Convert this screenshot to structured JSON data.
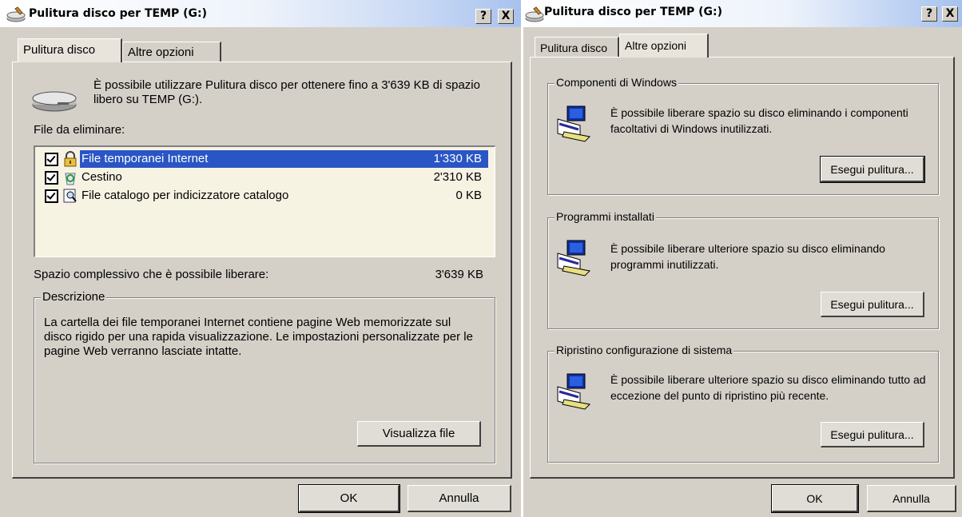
{
  "left_window": {
    "title": "Pulitura disco per TEMP (G:)",
    "help_btn": "?",
    "close_btn": "X",
    "tabs": [
      "Pulitura disco",
      "Altre opzioni"
    ],
    "intro": "È possibile utilizzare Pulitura disco per ottenere fino a 3'639 KB di spazio libero su TEMP (G:).",
    "files_label": "File da eliminare:",
    "files": [
      {
        "name": "File temporanei Internet",
        "size": "1'330 KB",
        "checked": true,
        "selected": true,
        "icon": "lock-icon"
      },
      {
        "name": "Cestino",
        "size": "2'310 KB",
        "checked": true,
        "selected": false,
        "icon": "recycle-bin-icon"
      },
      {
        "name": "File catalogo per indicizzatore catalogo",
        "size": "0 KB",
        "checked": true,
        "selected": false,
        "icon": "catalog-search-icon"
      }
    ],
    "total_label": "Spazio complessivo che è possibile liberare:",
    "total_value": "3'639 KB",
    "description_legend": "Descrizione",
    "description_text": "La cartella dei file temporanei Internet contiene pagine Web memorizzate sul disco rigido per una rapida visualizzazione. Le impostazioni personalizzate per le pagine Web verranno lasciate intatte.",
    "view_files_btn": "Visualizza file",
    "ok_btn": "OK",
    "cancel_btn": "Annulla"
  },
  "right_window": {
    "title": "Pulitura disco per TEMP (G:)",
    "help_btn": "?",
    "close_btn": "X",
    "tabs": [
      "Pulitura disco",
      "Altre opzioni"
    ],
    "groups": [
      {
        "legend": "Componenti di Windows",
        "text": "È possibile liberare spazio su disco eliminando i componenti facoltativi di Windows inutilizzati.",
        "button": "Esegui pulitura..."
      },
      {
        "legend": "Programmi installati",
        "text": "È possibile liberare ulteriore spazio su disco eliminando programmi inutilizzati.",
        "button": "Esegui pulitura..."
      },
      {
        "legend": "Ripristino configurazione di sistema",
        "text": "È possibile liberare ulteriore spazio su disco eliminando tutto ad eccezione del punto di ripristino più recente.",
        "button": "Esegui pulitura..."
      }
    ],
    "ok_btn": "OK",
    "cancel_btn": "Annulla"
  },
  "colors": {
    "selection": "#2a55c5",
    "dialog_bg": "#d4d0c8",
    "list_bg": "#f7f3e3"
  }
}
